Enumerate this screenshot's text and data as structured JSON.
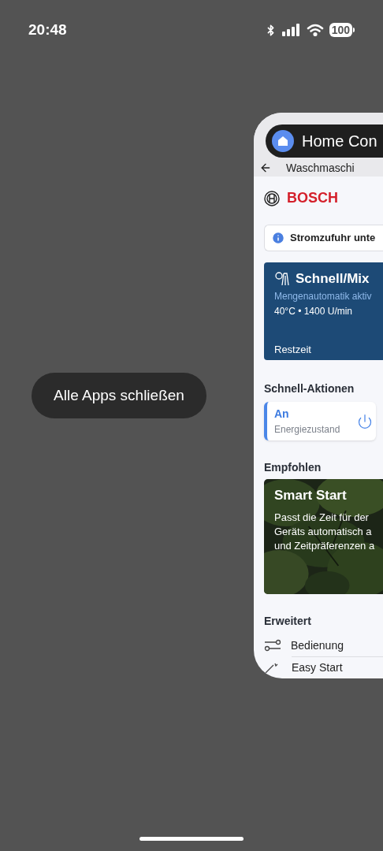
{
  "status_bar": {
    "time": "20:48",
    "battery": "100"
  },
  "close_all_button": "Alle Apps schließen",
  "app_card": {
    "app_title": "Home Con",
    "nav_title": "Waschmaschi",
    "brand": "BOSCH",
    "notice": "Stromzufuhr unte",
    "program": {
      "name": "Schnell/Mix",
      "subtitle": "Mengenautomatik aktiv",
      "settings": "40°C • 1400 U/min",
      "remaining_label": "Restzeit"
    },
    "quick_actions": {
      "heading": "Schnell-Aktionen",
      "items": [
        {
          "value": "An",
          "label": "Energiezustand",
          "on": true
        }
      ]
    },
    "recommended": {
      "heading": "Empfohlen",
      "cards": [
        {
          "title": "Smart Start",
          "lines": [
            "Passt die Zeit für der",
            "Geräts automatisch a",
            "und Zeitpräferenzen a"
          ]
        }
      ]
    },
    "advanced": {
      "heading": "Erweitert",
      "items": [
        {
          "label": "Bedienung",
          "kind": "sliders"
        },
        {
          "label": "Easy Start",
          "kind": "wand"
        }
      ]
    }
  }
}
